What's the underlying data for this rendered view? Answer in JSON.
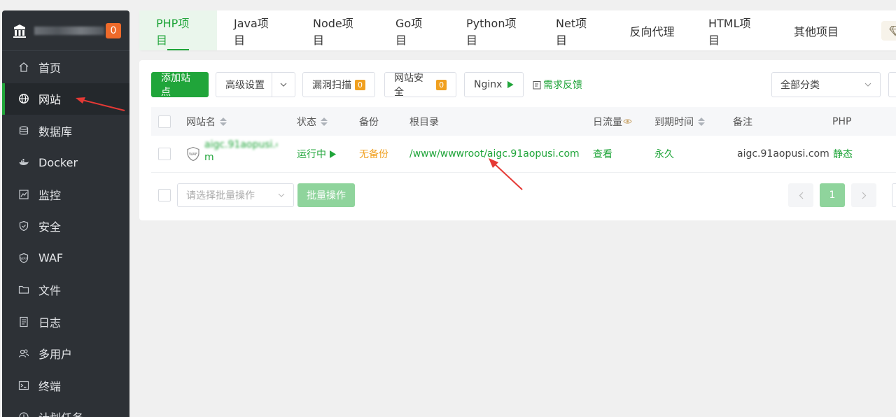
{
  "brand": {
    "badge": "0"
  },
  "sidebar": {
    "items": [
      {
        "label": "首页",
        "icon": "home-icon"
      },
      {
        "label": "网站",
        "icon": "globe-icon"
      },
      {
        "label": "数据库",
        "icon": "database-icon"
      },
      {
        "label": "Docker",
        "icon": "docker-icon"
      },
      {
        "label": "监控",
        "icon": "monitor-icon"
      },
      {
        "label": "安全",
        "icon": "shield-icon"
      },
      {
        "label": "WAF",
        "icon": "waf-icon"
      },
      {
        "label": "文件",
        "icon": "folder-icon"
      },
      {
        "label": "日志",
        "icon": "log-icon"
      },
      {
        "label": "多用户",
        "icon": "users-icon"
      },
      {
        "label": "终端",
        "icon": "terminal-icon"
      },
      {
        "label": "计划任务",
        "icon": "clock-icon"
      }
    ]
  },
  "tabs": [
    "PHP项目",
    "Java项目",
    "Node项目",
    "Go项目",
    "Python项目",
    "Net项目",
    "反向代理",
    "HTML项目",
    "其他项目"
  ],
  "toolbar": {
    "add_site": "添加站点",
    "advanced": "高级设置",
    "scan": "漏洞扫描",
    "scan_count": "0",
    "security": "网站安全",
    "security_count": "0",
    "nginx": "Nginx",
    "feedback": "需求反馈",
    "category": "全部分类"
  },
  "table": {
    "headers": {
      "name": "网站名",
      "status": "状态",
      "backup": "备份",
      "root": "根目录",
      "traffic": "日流量",
      "expire": "到期时间",
      "remark": "备注",
      "php": "PHP"
    },
    "rows": [
      {
        "name_line1": "aigc.91aopusi.co",
        "name_line2": "m",
        "status": "运行中",
        "backup": "无备份",
        "root": "/www/wwwroot/aigc.91aopusi.com",
        "traffic": "查看",
        "expire": "永久",
        "remark": "aigc.91aopusi.com",
        "php": "静态"
      }
    ]
  },
  "footer": {
    "batch_placeholder": "请选择批量操作",
    "batch_button": "批量操作",
    "page": "1"
  }
}
